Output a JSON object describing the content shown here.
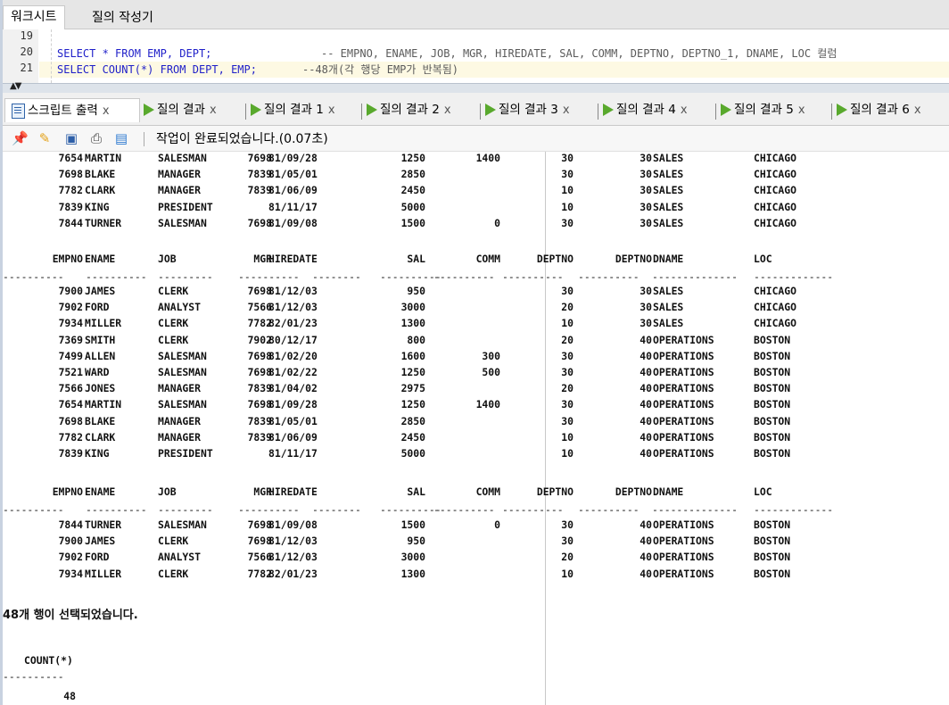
{
  "top_tabs": [
    "워크시트",
    "질의 작성기"
  ],
  "editor": {
    "lines": [
      {
        "num": "19",
        "sql": "",
        "comment": ""
      },
      {
        "num": "20",
        "sql": "SELECT * FROM EMP, DEPT;",
        "comment": "-- EMPNO, ENAME, JOB, MGR, HIREDATE, SAL, COMM, DEPTNO, DEPTNO_1, DNAME, LOC 컬럼"
      },
      {
        "num": "21",
        "sql": "SELECT COUNT(*) FROM DEPT, EMP;",
        "comment": "--48개(각 행당 EMP가 반복됨)"
      }
    ]
  },
  "result_tabs": [
    {
      "label": "스크립트 출력",
      "icon": "script-output-icon"
    },
    {
      "label": "질의 결과",
      "icon": "run-icon"
    },
    {
      "label": "질의 결과 1",
      "icon": "run-icon"
    },
    {
      "label": "질의 결과 2",
      "icon": "run-icon"
    },
    {
      "label": "질의 결과 3",
      "icon": "run-icon"
    },
    {
      "label": "질의 결과 4",
      "icon": "run-icon"
    },
    {
      "label": "질의 결과 5",
      "icon": "run-icon"
    },
    {
      "label": "질의 결과 6",
      "icon": "run-icon"
    }
  ],
  "tab_close": "x",
  "toolbar": {
    "icons": [
      "pin-icon",
      "eraser-icon",
      "save-icon",
      "print-icon",
      "document-icon"
    ],
    "status": "작업이 완료되었습니다.(0.07초)"
  },
  "columns": [
    "EMPNO",
    "ENAME",
    "JOB",
    "MGR",
    "HIREDATE",
    "SAL",
    "COMM",
    "DEPTNO",
    "DEPTNO",
    "DNAME",
    "LOC"
  ],
  "dashes": [
    "----------",
    "----------",
    "---------",
    "----------",
    "--------",
    "----------",
    "----------",
    "----------",
    "----------",
    "--------------",
    "-------------"
  ],
  "block1": [
    [
      "7654",
      "MARTIN",
      "SALESMAN",
      "7698",
      "81/09/28",
      "1250",
      "1400",
      "30",
      "30",
      "SALES",
      "CHICAGO"
    ],
    [
      "7698",
      "BLAKE",
      "MANAGER",
      "7839",
      "81/05/01",
      "2850",
      "",
      "30",
      "30",
      "SALES",
      "CHICAGO"
    ],
    [
      "7782",
      "CLARK",
      "MANAGER",
      "7839",
      "81/06/09",
      "2450",
      "",
      "10",
      "30",
      "SALES",
      "CHICAGO"
    ],
    [
      "7839",
      "KING",
      "PRESIDENT",
      "",
      "81/11/17",
      "5000",
      "",
      "10",
      "30",
      "SALES",
      "CHICAGO"
    ],
    [
      "7844",
      "TURNER",
      "SALESMAN",
      "7698",
      "81/09/08",
      "1500",
      "0",
      "30",
      "30",
      "SALES",
      "CHICAGO"
    ]
  ],
  "block2": [
    [
      "7900",
      "JAMES",
      "CLERK",
      "7698",
      "81/12/03",
      "950",
      "",
      "30",
      "30",
      "SALES",
      "CHICAGO"
    ],
    [
      "7902",
      "FORD",
      "ANALYST",
      "7566",
      "81/12/03",
      "3000",
      "",
      "20",
      "30",
      "SALES",
      "CHICAGO"
    ],
    [
      "7934",
      "MILLER",
      "CLERK",
      "7782",
      "82/01/23",
      "1300",
      "",
      "10",
      "30",
      "SALES",
      "CHICAGO"
    ],
    [
      "7369",
      "SMITH",
      "CLERK",
      "7902",
      "80/12/17",
      "800",
      "",
      "20",
      "40",
      "OPERATIONS",
      "BOSTON"
    ],
    [
      "7499",
      "ALLEN",
      "SALESMAN",
      "7698",
      "81/02/20",
      "1600",
      "300",
      "30",
      "40",
      "OPERATIONS",
      "BOSTON"
    ],
    [
      "7521",
      "WARD",
      "SALESMAN",
      "7698",
      "81/02/22",
      "1250",
      "500",
      "30",
      "40",
      "OPERATIONS",
      "BOSTON"
    ],
    [
      "7566",
      "JONES",
      "MANAGER",
      "7839",
      "81/04/02",
      "2975",
      "",
      "20",
      "40",
      "OPERATIONS",
      "BOSTON"
    ],
    [
      "7654",
      "MARTIN",
      "SALESMAN",
      "7698",
      "81/09/28",
      "1250",
      "1400",
      "30",
      "40",
      "OPERATIONS",
      "BOSTON"
    ],
    [
      "7698",
      "BLAKE",
      "MANAGER",
      "7839",
      "81/05/01",
      "2850",
      "",
      "30",
      "40",
      "OPERATIONS",
      "BOSTON"
    ],
    [
      "7782",
      "CLARK",
      "MANAGER",
      "7839",
      "81/06/09",
      "2450",
      "",
      "10",
      "40",
      "OPERATIONS",
      "BOSTON"
    ],
    [
      "7839",
      "KING",
      "PRESIDENT",
      "",
      "81/11/17",
      "5000",
      "",
      "10",
      "40",
      "OPERATIONS",
      "BOSTON"
    ]
  ],
  "block3": [
    [
      "7844",
      "TURNER",
      "SALESMAN",
      "7698",
      "81/09/08",
      "1500",
      "0",
      "30",
      "40",
      "OPERATIONS",
      "BOSTON"
    ],
    [
      "7900",
      "JAMES",
      "CLERK",
      "7698",
      "81/12/03",
      "950",
      "",
      "30",
      "40",
      "OPERATIONS",
      "BOSTON"
    ],
    [
      "7902",
      "FORD",
      "ANALYST",
      "7566",
      "81/12/03",
      "3000",
      "",
      "20",
      "40",
      "OPERATIONS",
      "BOSTON"
    ],
    [
      "7934",
      "MILLER",
      "CLERK",
      "7782",
      "82/01/23",
      "1300",
      "",
      "10",
      "40",
      "OPERATIONS",
      "BOSTON"
    ]
  ],
  "rows_selected_msg": "48개 행이 선택되었습니다.",
  "count_result": {
    "header": "COUNT(*)",
    "dash": "----------",
    "value": "48"
  }
}
